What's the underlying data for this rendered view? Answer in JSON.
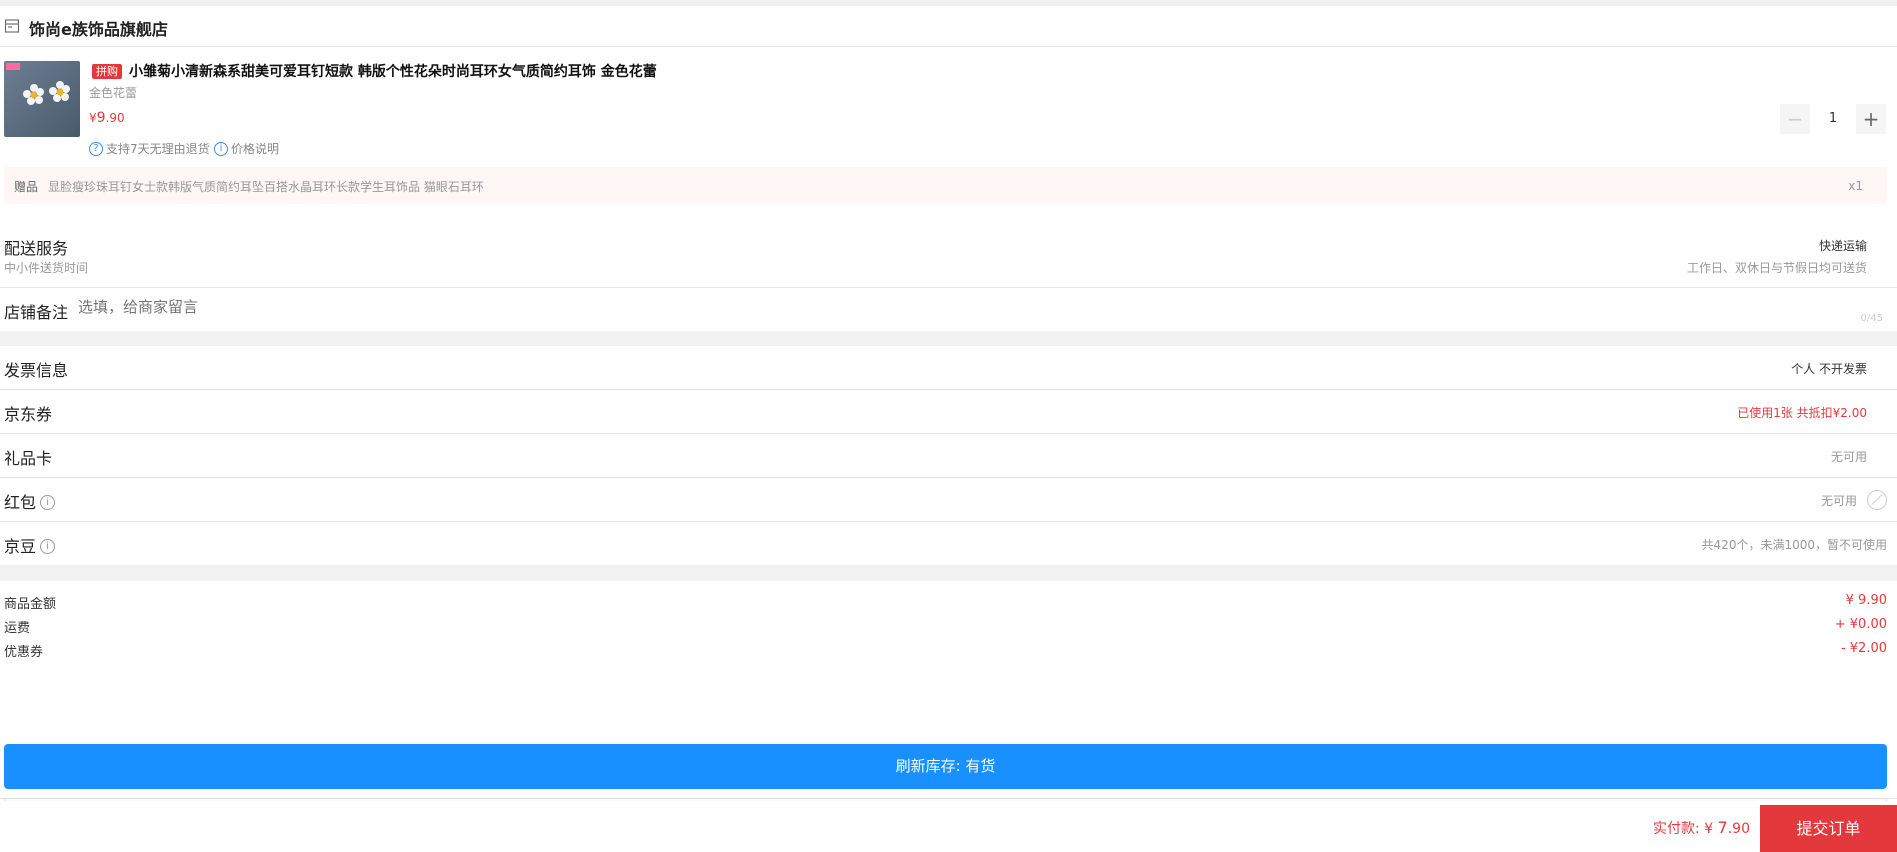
{
  "shop": {
    "name": "饰尚e族饰品旗舰店",
    "icon": "store-icon"
  },
  "product": {
    "tag": "拼购",
    "title": "小雏菊小清新森系甜美可爱耳钉短款 韩版个性花朵时尚耳环女气质简约耳饰 金色花蕾",
    "spec": "金色花蕾",
    "price_symbol": "¥",
    "price_int": "9",
    "price_dec": ".90",
    "service_return": "支持7天无理由退货",
    "service_price": "价格说明",
    "quantity": "1",
    "thumb_badge_color": "#ff6aa0"
  },
  "gift": {
    "label": "赠品",
    "text": "显脸瘦珍珠耳钉女士款韩版气质简约耳坠百搭水晶耳环长款学生耳饰品 猫眼石耳环",
    "qty": "x1"
  },
  "delivery": {
    "title": "配送服务",
    "sub": "中小件送货时间",
    "method": "快递运输",
    "time": "工作日、双休日与节假日均可送货"
  },
  "note": {
    "label": "店铺备注",
    "placeholder": "选填，给商家留言",
    "count": "0/45"
  },
  "rows": {
    "invoice": {
      "label": "发票信息",
      "value": "个人 不开发票"
    },
    "coupon": {
      "label": "京东券",
      "value": "已使用1张 共抵扣¥2.00"
    },
    "giftcard": {
      "label": "礼品卡",
      "value": "无可用"
    },
    "redpacket": {
      "label": "红包",
      "value": "无可用"
    },
    "jingdou": {
      "label": "京豆",
      "value": "共420个，未满1000，暂不可使用"
    }
  },
  "summary": {
    "goods_label": "商品金额",
    "goods_value": "¥ 9.90",
    "freight_label": "运费",
    "freight_value": "+ ¥0.00",
    "coupon_label": "优惠券",
    "coupon_value": "- ¥2.00"
  },
  "refresh": {
    "label": "刷新库存: 有货"
  },
  "footer": {
    "pay_label": "实付款: ",
    "pay_symbol": "¥ ",
    "pay_int": "7",
    "pay_dec": ".90",
    "submit": "提交订单"
  },
  "colors": {
    "accent": "#e4393c",
    "primary": "#1890ff"
  }
}
